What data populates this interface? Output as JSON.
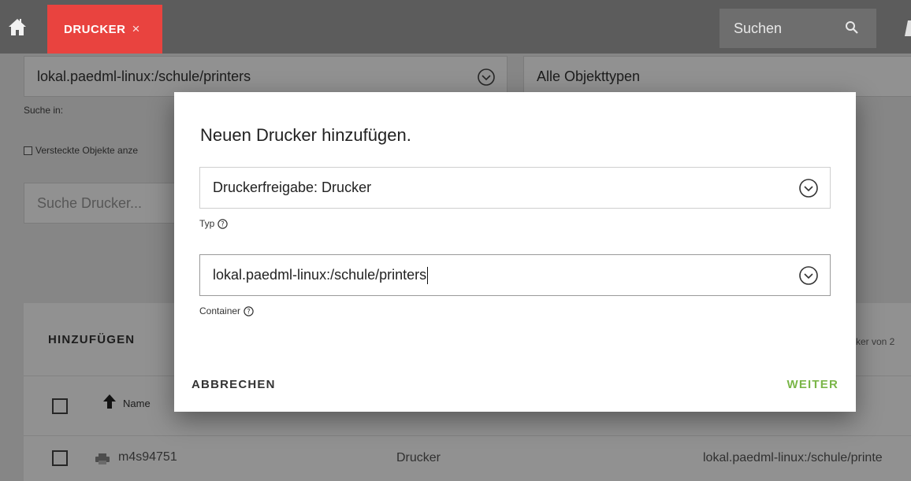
{
  "topbar": {
    "tab_label": "DRUCKER",
    "tab_close": "×",
    "search_placeholder": "Suchen"
  },
  "page": {
    "path_select": "lokal.paedml-linux:/schule/printers",
    "type_select": "Alle Objekttypen",
    "search_in_label": "Suche in:",
    "hidden_objects_label": "Versteckte Objekte anze",
    "search_printer_placeholder": "Suche Drucker...",
    "add_button": "HINZUFÜGEN",
    "count_text": "cker von 2",
    "col_name": "Name",
    "rows": [
      {
        "name": "m4s94751",
        "type": "Drucker",
        "path": "lokal.paedml-linux:/schule/printe"
      }
    ]
  },
  "dialog": {
    "title": "Neuen Drucker hinzufügen.",
    "type_value": "Druckerfreigabe: Drucker",
    "type_label": "Typ",
    "container_value": "lokal.paedml-linux:/schule/printers",
    "container_label": "Container",
    "cancel_button": "ABBRECHEN",
    "next_button": "WEITER"
  },
  "colors": {
    "topbar": "#5c5c5c",
    "tab_active": "#e9433f",
    "accent_green": "#7ab648"
  }
}
